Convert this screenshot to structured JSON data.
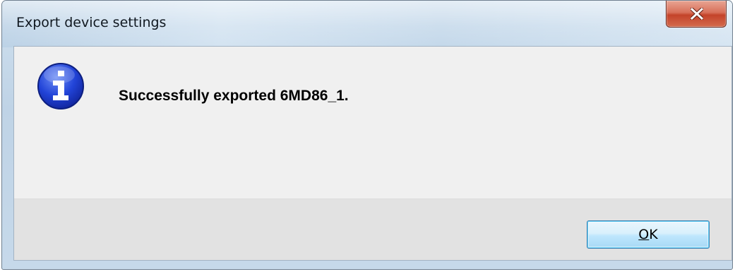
{
  "window": {
    "title": "Export device settings",
    "close_icon": "close-icon"
  },
  "message": {
    "icon": "info-icon",
    "text": "Successfully exported 6MD86_1."
  },
  "buttons": {
    "ok_label_underlined": "O",
    "ok_label_rest": "K"
  },
  "colors": {
    "close_button": "#c4432a",
    "info_icon": "#1b3fd0",
    "ok_border": "#3c7fb1"
  }
}
